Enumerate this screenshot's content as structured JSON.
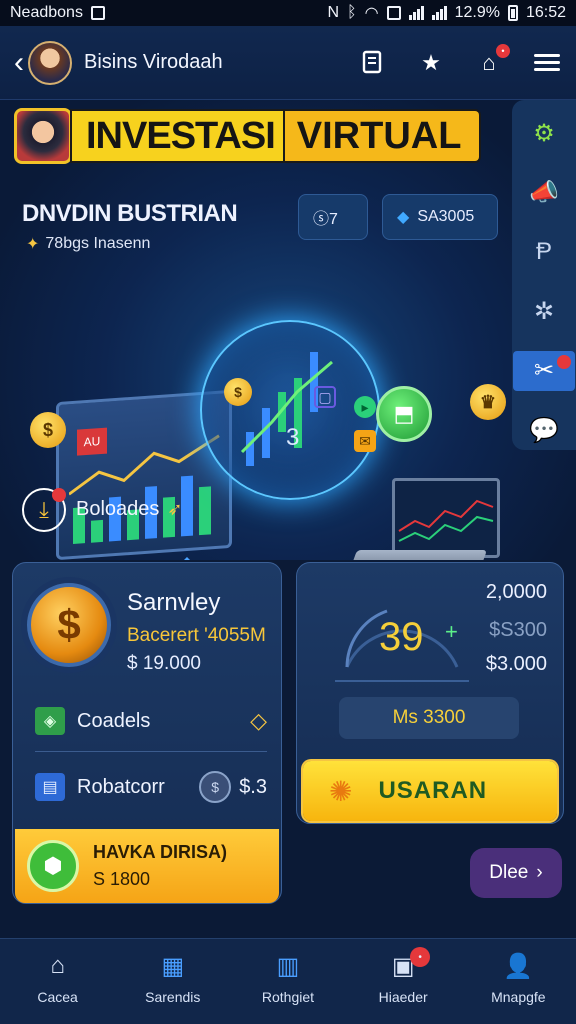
{
  "status_bar": {
    "carrier": "Neadbons",
    "battery_pct": "12.9%",
    "time": "16:52"
  },
  "app_bar": {
    "title": "Bisins Virodaah"
  },
  "hero": {
    "banner_left": "INVESTASI",
    "banner_right": "VIRTUAL",
    "heading": "DNVDIN BUSTRIAN",
    "subheading": "78bgs Inasenn",
    "chip1": "ⓢ7",
    "chip2": "SA3005",
    "ring_number": "3",
    "gift_label": "Boloades",
    "red_box": "AU"
  },
  "card_left": {
    "title": "Sarnvley",
    "subtitle": "Bacerert '4055M",
    "amount": "$ 19.000",
    "row1_label": "Coadels",
    "row2_label": "Robatcorr",
    "row2_value": "$.3",
    "promo_line1": "HAVKA DIRISA)",
    "promo_line2": "S 1800"
  },
  "card_right": {
    "gauge_value": "39",
    "value1": "2,0000",
    "value2": "$S300",
    "value3": "$3.000",
    "ms_label": "Ms 3300",
    "cta_label": "USARAN"
  },
  "pill": {
    "label": "Dlee"
  },
  "bottom_nav": [
    {
      "label": "Cacea"
    },
    {
      "label": "Sarendis"
    },
    {
      "label": "Rothgiet"
    },
    {
      "label": "Hiaeder"
    },
    {
      "label": "Mnapgfe"
    }
  ],
  "colors": {
    "accent_yellow": "#f7d21e",
    "background": "#0b1a36",
    "card": "#1d3a66",
    "highlight_blue": "#2c6ccd"
  }
}
